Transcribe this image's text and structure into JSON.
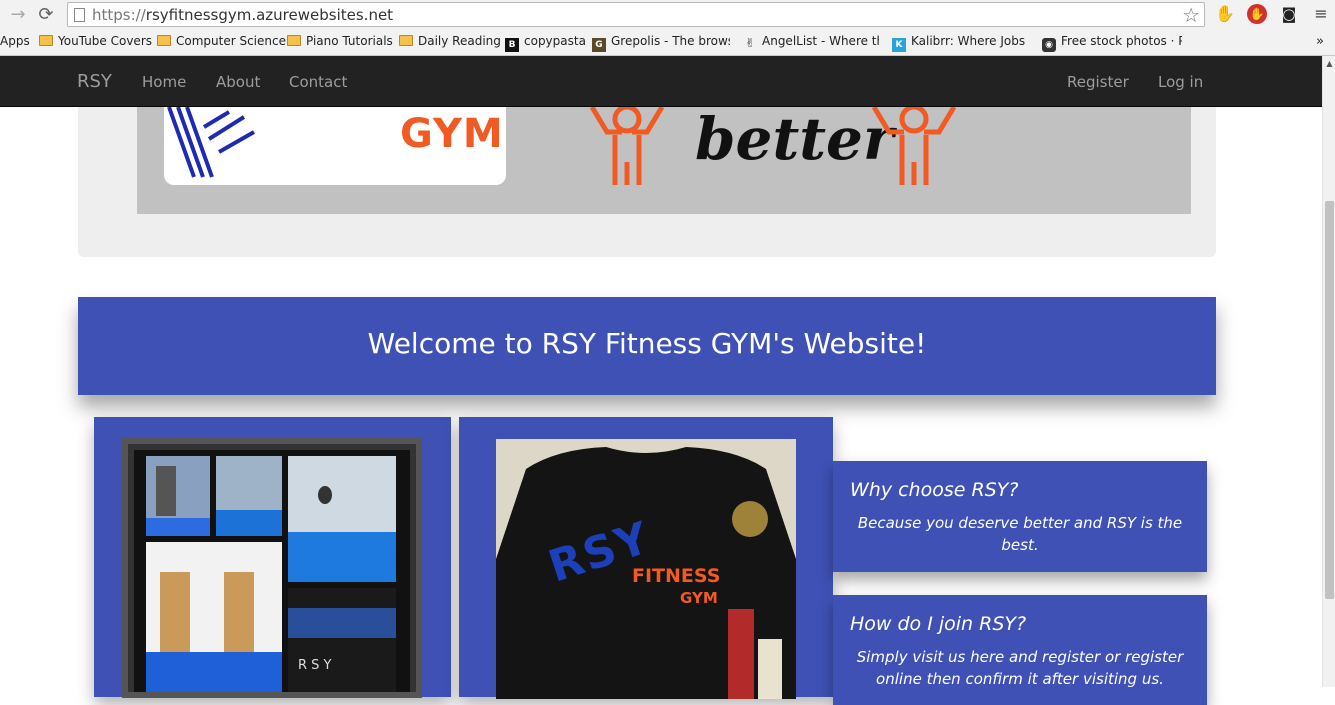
{
  "browser": {
    "url_scheme": "https://",
    "url_host": "rsyfitnessgym.azurewebsites.net",
    "bookmarks": [
      {
        "label": "Apps",
        "icon": "apps-grid-icon"
      },
      {
        "label": "YouTube Covers",
        "icon": "folder-icon"
      },
      {
        "label": "Computer Science",
        "icon": "folder-icon"
      },
      {
        "label": "Piano Tutorials",
        "icon": "folder-icon"
      },
      {
        "label": "Daily Reading",
        "icon": "folder-icon"
      },
      {
        "label": "copypasta",
        "icon": "b-favicon"
      },
      {
        "label": "Grepolis - The browse",
        "icon": "g-favicon"
      },
      {
        "label": "AngelList - Where the",
        "icon": "angellist-icon"
      },
      {
        "label": "Kalibrr: Where Jobs Fi",
        "icon": "k-favicon"
      },
      {
        "label": "Free stock photos · Pe",
        "icon": "camera-icon"
      }
    ],
    "overflow_label": "»"
  },
  "navbar": {
    "brand": "RSY",
    "links": [
      "Home",
      "About",
      "Contact"
    ],
    "right_links": [
      "Register",
      "Log in"
    ]
  },
  "banner": {
    "logo_text": "GYM",
    "tagline": "better"
  },
  "welcome": {
    "heading": "Welcome to RSY Fitness GYM's Website!"
  },
  "gallery": {
    "photo_caption": "R S Y",
    "shirt_line1": "RSY",
    "shirt_line2": "FITNESS",
    "shirt_line3": "GYM"
  },
  "info_cards": [
    {
      "title": "Why choose RSY?",
      "body": "Because you deserve better and RSY is the best."
    },
    {
      "title": "How do I join RSY?",
      "body": "Simply visit us here and register or register online then confirm it after visiting us."
    }
  ],
  "colors": {
    "primary_blue": "#3f51b5",
    "navbar": "#222222",
    "accent_orange": "#f15a22"
  }
}
